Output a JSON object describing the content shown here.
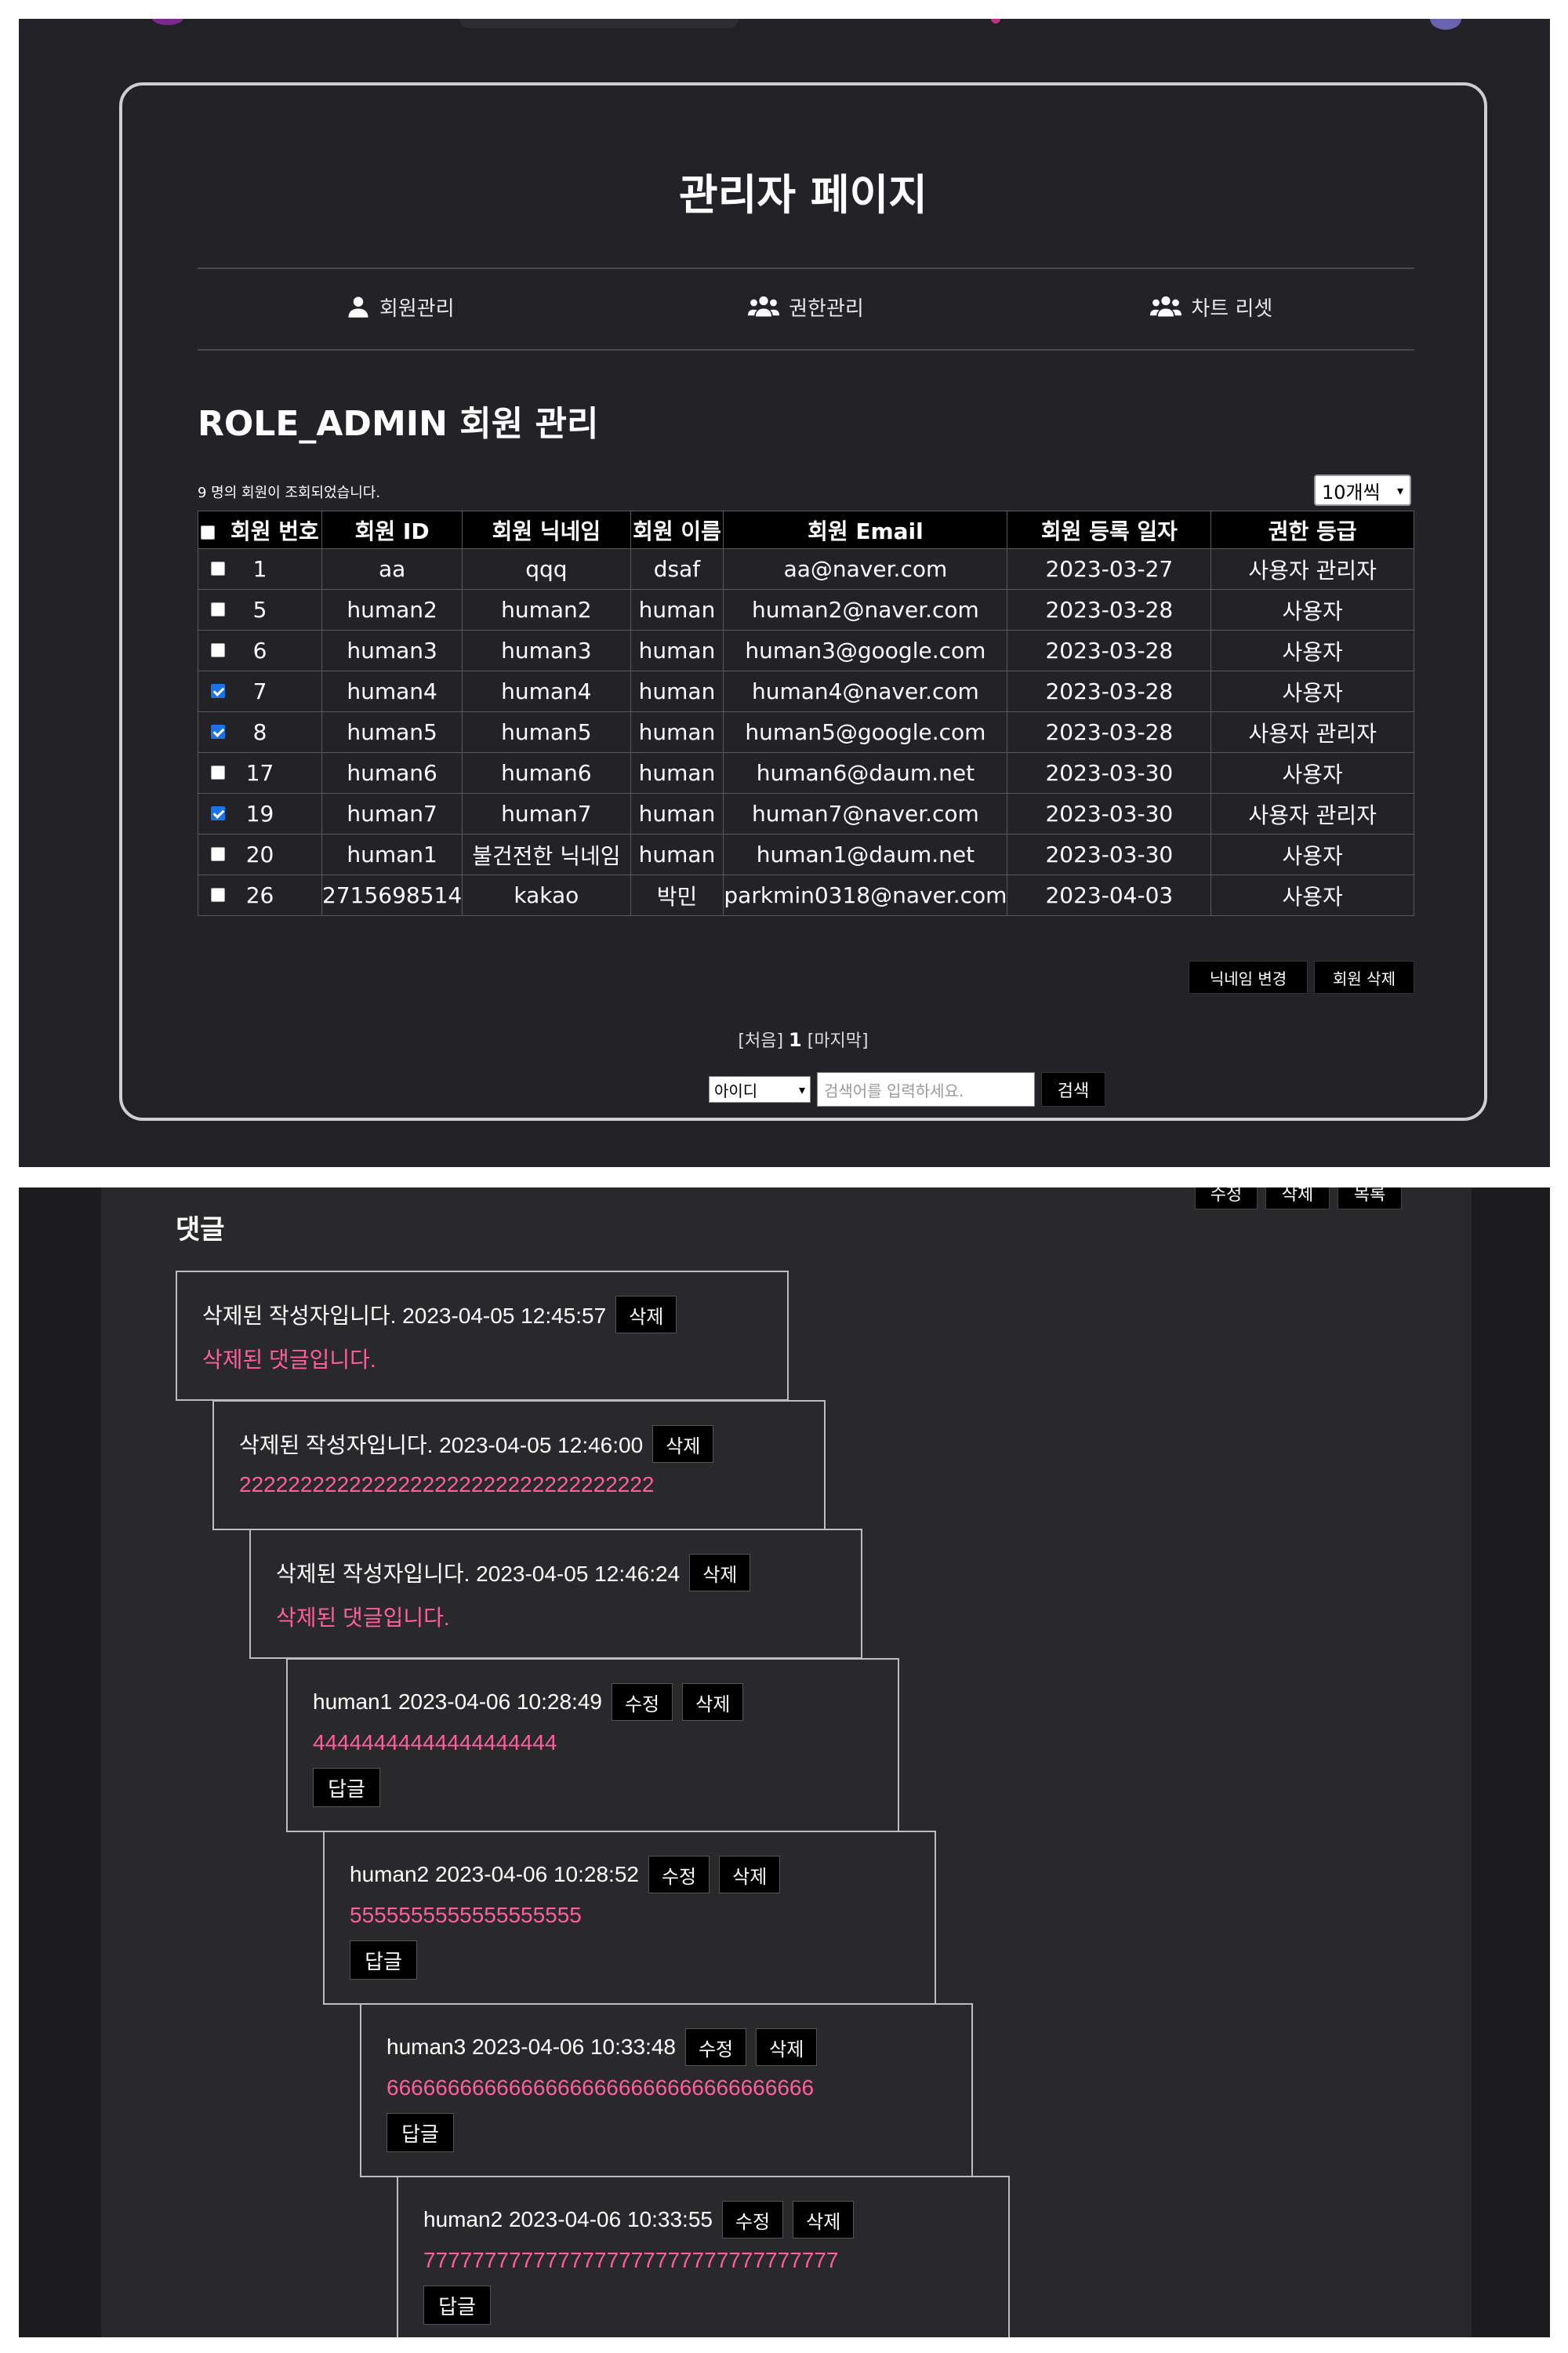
{
  "admin": {
    "title": "관리자 페이지",
    "nav": [
      {
        "label": "회원관리",
        "icon": "user-icon"
      },
      {
        "label": "권한관리",
        "icon": "users-icon"
      },
      {
        "label": "차트 리셋",
        "icon": "users-icon"
      }
    ],
    "section_title": "ROLE_ADMIN 회원 관리",
    "count_text": "9 명의 회원이 조회되었습니다.",
    "page_size": "10개씩",
    "table": {
      "headers": [
        "회원 번호",
        "회원 ID",
        "회원 닉네임",
        "회원 이름",
        "회원 Email",
        "회원 등록 일자",
        "권한 등급"
      ],
      "rows": [
        {
          "checked": false,
          "cells": [
            "1",
            "aa",
            "qqq",
            "dsaf",
            "aa@naver.com",
            "2023-03-27",
            "사용자 관리자"
          ]
        },
        {
          "checked": false,
          "cells": [
            "5",
            "human2",
            "human2",
            "human",
            "human2@naver.com",
            "2023-03-28",
            "사용자"
          ]
        },
        {
          "checked": false,
          "cells": [
            "6",
            "human3",
            "human3",
            "human",
            "human3@google.com",
            "2023-03-28",
            "사용자"
          ]
        },
        {
          "checked": true,
          "cells": [
            "7",
            "human4",
            "human4",
            "human",
            "human4@naver.com",
            "2023-03-28",
            "사용자"
          ]
        },
        {
          "checked": true,
          "cells": [
            "8",
            "human5",
            "human5",
            "human",
            "human5@google.com",
            "2023-03-28",
            "사용자 관리자"
          ]
        },
        {
          "checked": false,
          "cells": [
            "17",
            "human6",
            "human6",
            "human",
            "human6@daum.net",
            "2023-03-30",
            "사용자"
          ]
        },
        {
          "checked": true,
          "cells": [
            "19",
            "human7",
            "human7",
            "human",
            "human7@naver.com",
            "2023-03-30",
            "사용자 관리자"
          ]
        },
        {
          "checked": false,
          "cells": [
            "20",
            "human1",
            "불건전한 닉네임",
            "human",
            "human1@daum.net",
            "2023-03-30",
            "사용자"
          ]
        },
        {
          "checked": false,
          "cells": [
            "26",
            "2715698514",
            "kakao",
            "박민",
            "parkmin0318@naver.com",
            "2023-04-03",
            "사용자"
          ]
        }
      ]
    },
    "buttons": {
      "change_nick": "닉네임 변경",
      "delete_member": "회원 삭제"
    },
    "pager": {
      "first": "[처음]",
      "current": "1",
      "last": "[마지막]"
    },
    "search": {
      "field": "아이디",
      "placeholder": "검색어를 입력하세요.",
      "button": "검색"
    }
  },
  "comments": {
    "heading": "댓글",
    "top_buttons": [
      "수정",
      "삭제",
      "목록"
    ],
    "items": [
      {
        "header": "삭제된 작성자입니다. 2023-04-05 12:45:57",
        "text": "삭제된 댓글입니다.",
        "buttons": [
          "삭제"
        ],
        "reply": null
      },
      {
        "header": "삭제된 작성자입니다. 2023-04-05 12:46:00",
        "text": "2222222222222222222222222222222222",
        "buttons": [
          "삭제"
        ],
        "reply": null
      },
      {
        "header": "삭제된 작성자입니다. 2023-04-05 12:46:24",
        "text": "삭제된 댓글입니다.",
        "buttons": [
          "삭제"
        ],
        "reply": null
      },
      {
        "header": "human1 2023-04-06 10:28:49",
        "text": "44444444444444444444",
        "buttons": [
          "수정",
          "삭제"
        ],
        "reply": "답글"
      },
      {
        "header": "human2 2023-04-06 10:28:52",
        "text": "5555555555555555555",
        "buttons": [
          "수정",
          "삭제"
        ],
        "reply": "답글"
      },
      {
        "header": "human3 2023-04-06 10:33:48",
        "text": "66666666666666666666666666666666666",
        "buttons": [
          "수정",
          "삭제"
        ],
        "reply": "답글"
      },
      {
        "header": "human2 2023-04-06 10:33:55",
        "text": "7777777777777777777777777777777777",
        "buttons": [
          "수정",
          "삭제"
        ],
        "reply": "답글"
      }
    ]
  }
}
